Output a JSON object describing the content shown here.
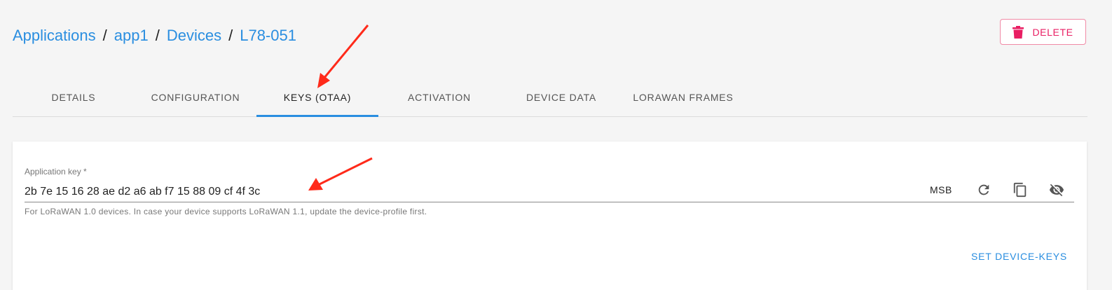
{
  "breadcrumb": {
    "items": [
      "Applications",
      "app1",
      "Devices",
      "L78-051"
    ],
    "separator": "/"
  },
  "delete_button": {
    "label": "DELETE",
    "icon": "trash-icon",
    "color": "#e91e63"
  },
  "tabs": [
    {
      "label": "DETAILS",
      "active": false
    },
    {
      "label": "CONFIGURATION",
      "active": false
    },
    {
      "label": "KEYS (OTAA)",
      "active": true
    },
    {
      "label": "ACTIVATION",
      "active": false
    },
    {
      "label": "DEVICE DATA",
      "active": false
    },
    {
      "label": "LORAWAN FRAMES",
      "active": false
    }
  ],
  "form": {
    "app_key_label": "Application key *",
    "app_key_value": "2b 7e 15 16 28 ae d2 a6 ab f7 15 88 09 cf 4f 3c",
    "byte_order": "MSB",
    "actions": [
      "refresh-icon",
      "copy-icon",
      "visibility-off-icon"
    ],
    "helper_text": "For LoRaWAN 1.0 devices. In case your device supports LoRaWAN 1.1, update the device-profile first.",
    "submit_label": "SET DEVICE-KEYS"
  },
  "colors": {
    "accent": "#2a8ee0",
    "danger": "#e91e63",
    "annotation": "#ff2a1a"
  }
}
